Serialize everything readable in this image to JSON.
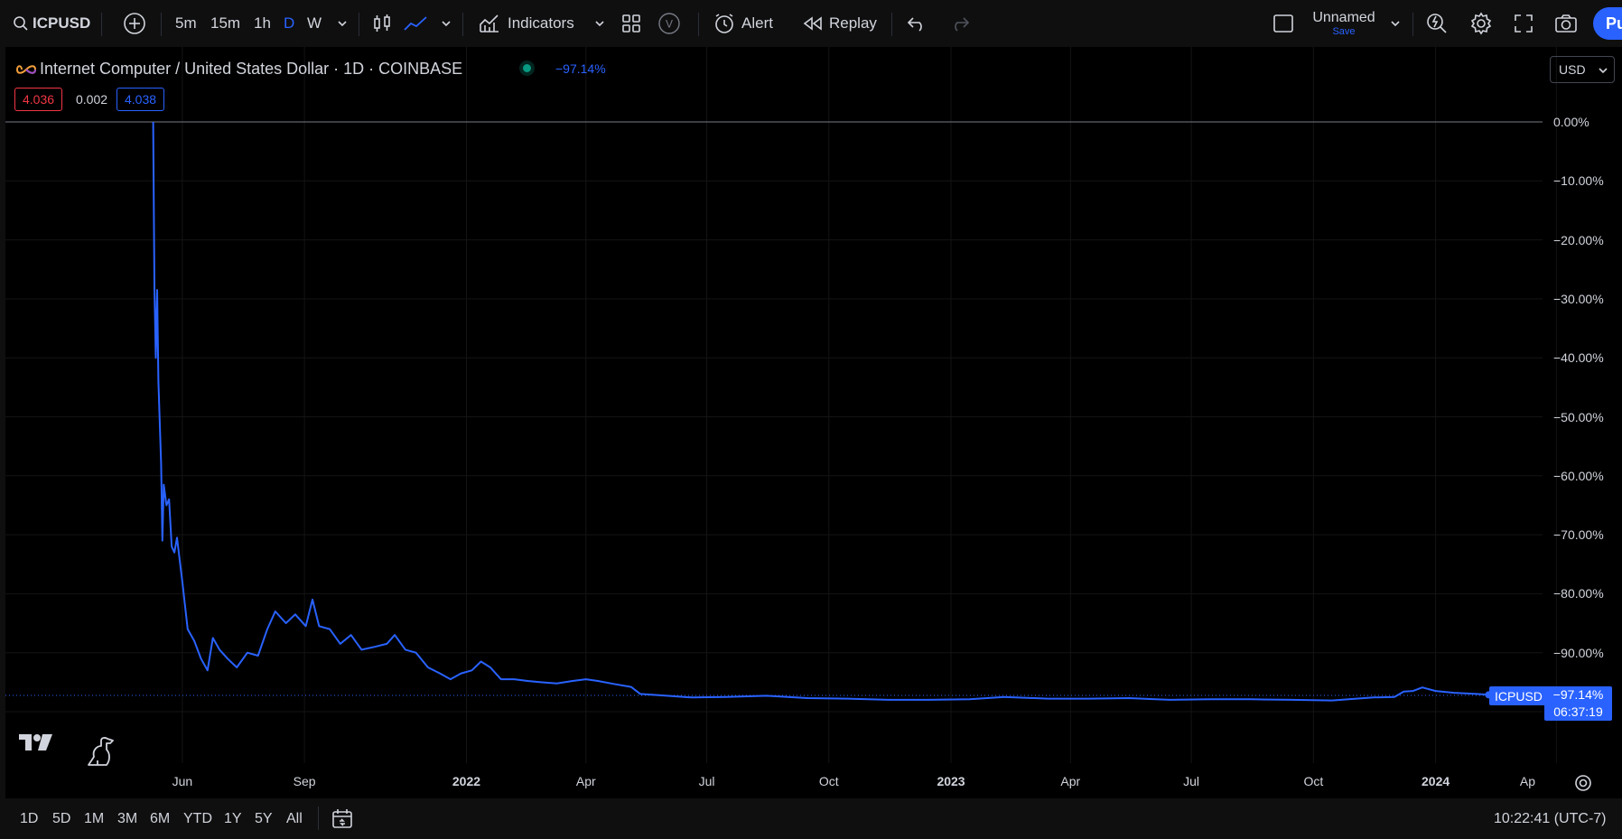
{
  "toolbar": {
    "symbol": "ICPUSD",
    "timeframes": [
      "5m",
      "15m",
      "1h",
      "D",
      "W"
    ],
    "active_timeframe": "D",
    "indicators_label": "Indicators",
    "alert_label": "Alert",
    "replay_label": "Replay",
    "layout_name": "Unnamed",
    "save_label": "Save",
    "publish_label": "Pu",
    "v_label": "V"
  },
  "legend": {
    "title": "Internet Computer / United States Dollar · 1D · COINBASE",
    "change": "−97.14%",
    "bid": "4.036",
    "spread": "0.002",
    "ask": "4.038"
  },
  "price_axis": {
    "currency": "USD",
    "labels": [
      "0.00%",
      "−10.00%",
      "−20.00%",
      "−30.00%",
      "−40.00%",
      "−50.00%",
      "−60.00%",
      "−70.00%",
      "−80.00%",
      "−90.00%"
    ],
    "last_symbol": "ICPUSD",
    "last_value": "−97.14%",
    "countdown": "06:37:19"
  },
  "time_axis": {
    "labels": [
      {
        "text": "Jun",
        "bold": false
      },
      {
        "text": "Sep",
        "bold": false
      },
      {
        "text": "2022",
        "bold": true
      },
      {
        "text": "Apr",
        "bold": false
      },
      {
        "text": "Jul",
        "bold": false
      },
      {
        "text": "Oct",
        "bold": false
      },
      {
        "text": "2023",
        "bold": true
      },
      {
        "text": "Apr",
        "bold": false
      },
      {
        "text": "Jul",
        "bold": false
      },
      {
        "text": "Oct",
        "bold": false
      },
      {
        "text": "2024",
        "bold": true
      },
      {
        "text": "Ap",
        "bold": false
      }
    ]
  },
  "bottom": {
    "ranges": [
      "1D",
      "5D",
      "1M",
      "3M",
      "6M",
      "YTD",
      "1Y",
      "5Y",
      "All"
    ],
    "clock": "10:22:41 (UTC-7)"
  },
  "colors": {
    "line": "#2962ff",
    "background": "#000000",
    "grid": "#141414",
    "text": "#d1d4dc",
    "bid": "#f23645",
    "live": "#089981"
  },
  "chart_data": {
    "type": "line",
    "series_unit": "percent change",
    "ylim": [
      -100,
      0
    ],
    "points": [
      {
        "x": "2021-05-10",
        "y": 0.0
      },
      {
        "x": "2021-05-11",
        "y": -28.0
      },
      {
        "x": "2021-05-12",
        "y": -40.0
      },
      {
        "x": "2021-05-13",
        "y": -28.5
      },
      {
        "x": "2021-05-14",
        "y": -44.0
      },
      {
        "x": "2021-05-16",
        "y": -58.0
      },
      {
        "x": "2021-05-17",
        "y": -71.0
      },
      {
        "x": "2021-05-18",
        "y": -61.5
      },
      {
        "x": "2021-05-20",
        "y": -65.0
      },
      {
        "x": "2021-05-22",
        "y": -64.0
      },
      {
        "x": "2021-05-24",
        "y": -72.0
      },
      {
        "x": "2021-05-26",
        "y": -73.0
      },
      {
        "x": "2021-05-28",
        "y": -70.5
      },
      {
        "x": "2021-06-01",
        "y": -78.0
      },
      {
        "x": "2021-06-05",
        "y": -86.0
      },
      {
        "x": "2021-06-10",
        "y": -88.0
      },
      {
        "x": "2021-06-15",
        "y": -91.0
      },
      {
        "x": "2021-06-20",
        "y": -93.0
      },
      {
        "x": "2021-06-24",
        "y": -87.5
      },
      {
        "x": "2021-06-29",
        "y": -89.5
      },
      {
        "x": "2021-07-05",
        "y": -91.0
      },
      {
        "x": "2021-07-12",
        "y": -92.5
      },
      {
        "x": "2021-07-20",
        "y": -90.0
      },
      {
        "x": "2021-07-28",
        "y": -90.5
      },
      {
        "x": "2021-08-04",
        "y": -86.0
      },
      {
        "x": "2021-08-10",
        "y": -83.0
      },
      {
        "x": "2021-08-18",
        "y": -85.0
      },
      {
        "x": "2021-08-25",
        "y": -83.5
      },
      {
        "x": "2021-09-02",
        "y": -85.5
      },
      {
        "x": "2021-09-07",
        "y": -81.0
      },
      {
        "x": "2021-09-12",
        "y": -85.5
      },
      {
        "x": "2021-09-20",
        "y": -86.0
      },
      {
        "x": "2021-09-28",
        "y": -88.5
      },
      {
        "x": "2021-10-06",
        "y": -87.0
      },
      {
        "x": "2021-10-14",
        "y": -89.5
      },
      {
        "x": "2021-10-24",
        "y": -89.0
      },
      {
        "x": "2021-11-02",
        "y": -88.5
      },
      {
        "x": "2021-11-08",
        "y": -87.0
      },
      {
        "x": "2021-11-16",
        "y": -89.5
      },
      {
        "x": "2021-11-24",
        "y": -90.0
      },
      {
        "x": "2021-12-03",
        "y": -92.5
      },
      {
        "x": "2021-12-12",
        "y": -93.5
      },
      {
        "x": "2021-12-20",
        "y": -94.5
      },
      {
        "x": "2021-12-28",
        "y": -93.5
      },
      {
        "x": "2022-01-05",
        "y": -93.0
      },
      {
        "x": "2022-01-12",
        "y": -91.5
      },
      {
        "x": "2022-01-19",
        "y": -92.5
      },
      {
        "x": "2022-01-27",
        "y": -94.5
      },
      {
        "x": "2022-02-06",
        "y": -94.5
      },
      {
        "x": "2022-02-16",
        "y": -94.8
      },
      {
        "x": "2022-02-26",
        "y": -95.0
      },
      {
        "x": "2022-03-10",
        "y": -95.2
      },
      {
        "x": "2022-03-22",
        "y": -94.8
      },
      {
        "x": "2022-04-01",
        "y": -94.5
      },
      {
        "x": "2022-04-10",
        "y": -94.8
      },
      {
        "x": "2022-04-22",
        "y": -95.3
      },
      {
        "x": "2022-05-05",
        "y": -95.8
      },
      {
        "x": "2022-05-12",
        "y": -97.0
      },
      {
        "x": "2022-06-01",
        "y": -97.3
      },
      {
        "x": "2022-06-20",
        "y": -97.6
      },
      {
        "x": "2022-07-15",
        "y": -97.5
      },
      {
        "x": "2022-08-15",
        "y": -97.3
      },
      {
        "x": "2022-09-15",
        "y": -97.7
      },
      {
        "x": "2022-10-15",
        "y": -97.8
      },
      {
        "x": "2022-11-15",
        "y": -98.0
      },
      {
        "x": "2022-12-15",
        "y": -98.0
      },
      {
        "x": "2023-01-15",
        "y": -97.9
      },
      {
        "x": "2023-02-10",
        "y": -97.5
      },
      {
        "x": "2023-03-15",
        "y": -97.8
      },
      {
        "x": "2023-04-15",
        "y": -97.8
      },
      {
        "x": "2023-05-15",
        "y": -97.7
      },
      {
        "x": "2023-06-15",
        "y": -98.0
      },
      {
        "x": "2023-07-15",
        "y": -97.9
      },
      {
        "x": "2023-08-15",
        "y": -97.9
      },
      {
        "x": "2023-09-15",
        "y": -98.0
      },
      {
        "x": "2023-10-15",
        "y": -98.1
      },
      {
        "x": "2023-11-15",
        "y": -97.6
      },
      {
        "x": "2023-12-01",
        "y": -97.5
      },
      {
        "x": "2023-12-08",
        "y": -96.6
      },
      {
        "x": "2023-12-15",
        "y": -96.5
      },
      {
        "x": "2023-12-22",
        "y": -95.9
      },
      {
        "x": "2024-01-01",
        "y": -96.5
      },
      {
        "x": "2024-01-15",
        "y": -96.8
      },
      {
        "x": "2024-02-01",
        "y": -97.0
      },
      {
        "x": "2024-02-10",
        "y": -97.14
      }
    ]
  }
}
